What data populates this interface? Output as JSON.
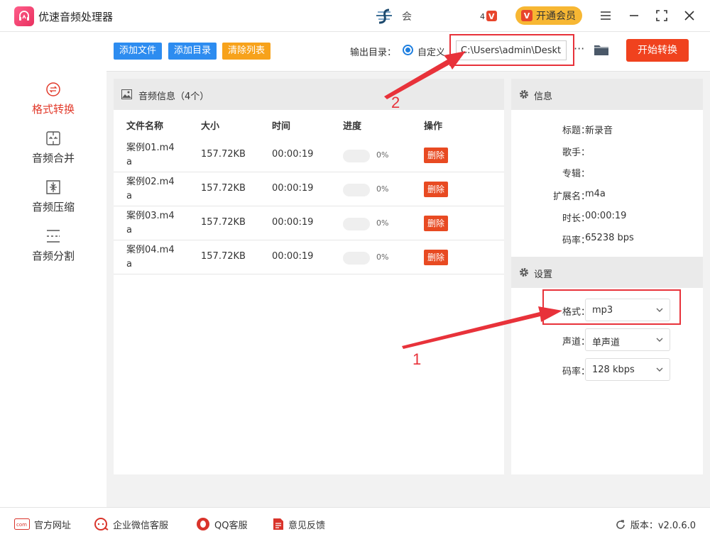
{
  "app": {
    "title": "优速音频处理器",
    "user_name": "会"
  },
  "header": {
    "vip_label": "开通会员"
  },
  "sidebar": {
    "items": [
      {
        "label": "格式转换",
        "icon": "format-convert-icon",
        "active": true
      },
      {
        "label": "音频合并",
        "icon": "merge-icon",
        "active": false
      },
      {
        "label": "音频压缩",
        "icon": "compress-icon",
        "active": false
      },
      {
        "label": "音频分割",
        "icon": "split-icon",
        "active": false
      }
    ]
  },
  "toolbar": {
    "add_file": "添加文件",
    "add_dir": "添加目录",
    "clear_list": "清除列表",
    "output_label": "输出目录：",
    "custom_label": "自定义",
    "output_path": "C:\\Users\\admin\\Deskto",
    "more": "···",
    "start": "开始转换",
    "colors": {
      "blue": "#2d8cf0",
      "orange": "#f7a21b",
      "red": "#f0421e"
    }
  },
  "list": {
    "title": "音频信息（4个）",
    "columns": [
      "文件名称",
      "大小",
      "时间",
      "进度",
      "操作"
    ],
    "rows": [
      {
        "name": "案例01.m4a",
        "size": "157.72KB",
        "time": "00:00:19",
        "progress": "0%",
        "action": "删除"
      },
      {
        "name": "案例02.m4a",
        "size": "157.72KB",
        "time": "00:00:19",
        "progress": "0%",
        "action": "删除"
      },
      {
        "name": "案例03.m4a",
        "size": "157.72KB",
        "time": "00:00:19",
        "progress": "0%",
        "action": "删除"
      },
      {
        "name": "案例04.m4a",
        "size": "157.72KB",
        "time": "00:00:19",
        "progress": "0%",
        "action": "删除"
      }
    ]
  },
  "info": {
    "title": "信息",
    "fields": [
      {
        "key": "标题：",
        "value": "新录音"
      },
      {
        "key": "歌手：",
        "value": ""
      },
      {
        "key": "专辑：",
        "value": ""
      },
      {
        "key": "扩展名：",
        "value": "m4a"
      },
      {
        "key": "时长：",
        "value": "00:00:19"
      },
      {
        "key": "码率：",
        "value": "65238 bps"
      }
    ]
  },
  "settings": {
    "title": "设置",
    "format_label": "格式：",
    "format_value": "mp3",
    "channel_label": "声道：",
    "channel_value": "单声道",
    "bitrate_label": "码率：",
    "bitrate_value": "128 kbps"
  },
  "annotations": {
    "num1": "1",
    "num2": "2",
    "color": "#e8323a"
  },
  "footer": {
    "website": "官方网址",
    "wechat": "企业微信客服",
    "qq": "QQ客服",
    "feedback": "意见反馈",
    "version": "版本：v2.0.6.0"
  }
}
